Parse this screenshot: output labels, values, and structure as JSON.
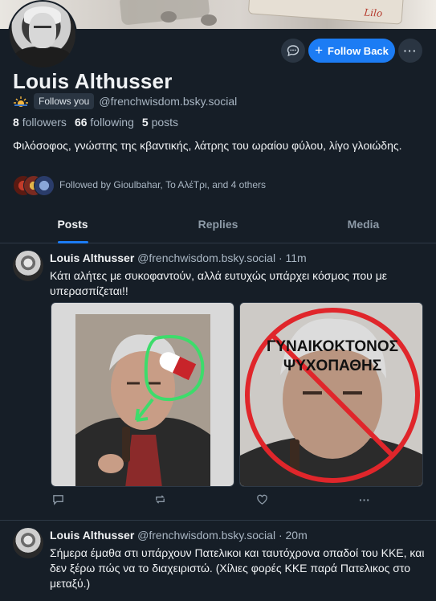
{
  "profile": {
    "name": "Louis Althusser",
    "follows_you_label": "Follows you",
    "handle": "@frenchwisdom.bsky.social",
    "followers_count": "8",
    "followers_label": "followers",
    "following_count": "66",
    "following_label": "following",
    "posts_count": "5",
    "posts_label": "posts",
    "bio": "Φιλόσοφος, γνώστης της κβαντικής, λάτρης του ωραίου φύλου, λίγο γλοιώδης.",
    "followed_by": "Followed by Gioulbahar, Το ΑλέΤρι, and 4 others"
  },
  "actions": {
    "follow_back_label": "Follow Back",
    "message_icon": "chat-bubble-icon",
    "more_icon": "ellipsis-icon"
  },
  "tabs": [
    {
      "label": "Posts",
      "active": true
    },
    {
      "label": "Replies",
      "active": false
    },
    {
      "label": "Media",
      "active": false
    }
  ],
  "posts": [
    {
      "author": "Louis Althusser",
      "handle": "@frenchwisdom.bsky.social",
      "time": "· 11m",
      "text": "Κάτι αλήτες με συκοφαντούν, αλλά ευτυχώς υπάρχει κόσμος που με υπερασπίζεται!!",
      "image2_caption_line1": "ΓΥΝΑΙΚΟΚΤΟΝΟΣ",
      "image2_caption_line2": "ΨΥΧΟΠΑΘΗΣ"
    },
    {
      "author": "Louis Althusser",
      "handle": "@frenchwisdom.bsky.social",
      "time": "· 20m",
      "text": "Σήμερα έμαθα στι υπάρχουν Πατελικοι και ταυτόχρονα οπαδοί του ΚΚΕ, και δεν ξέρω πώς να το διαχειριστώ. (Χίλιες φορές ΚΚΕ παρά Πατελικος στο μεταξύ.)"
    }
  ],
  "colors": {
    "background": "#161e27",
    "accent": "#1c7cf4",
    "muted_text": "#a9b6c3"
  }
}
